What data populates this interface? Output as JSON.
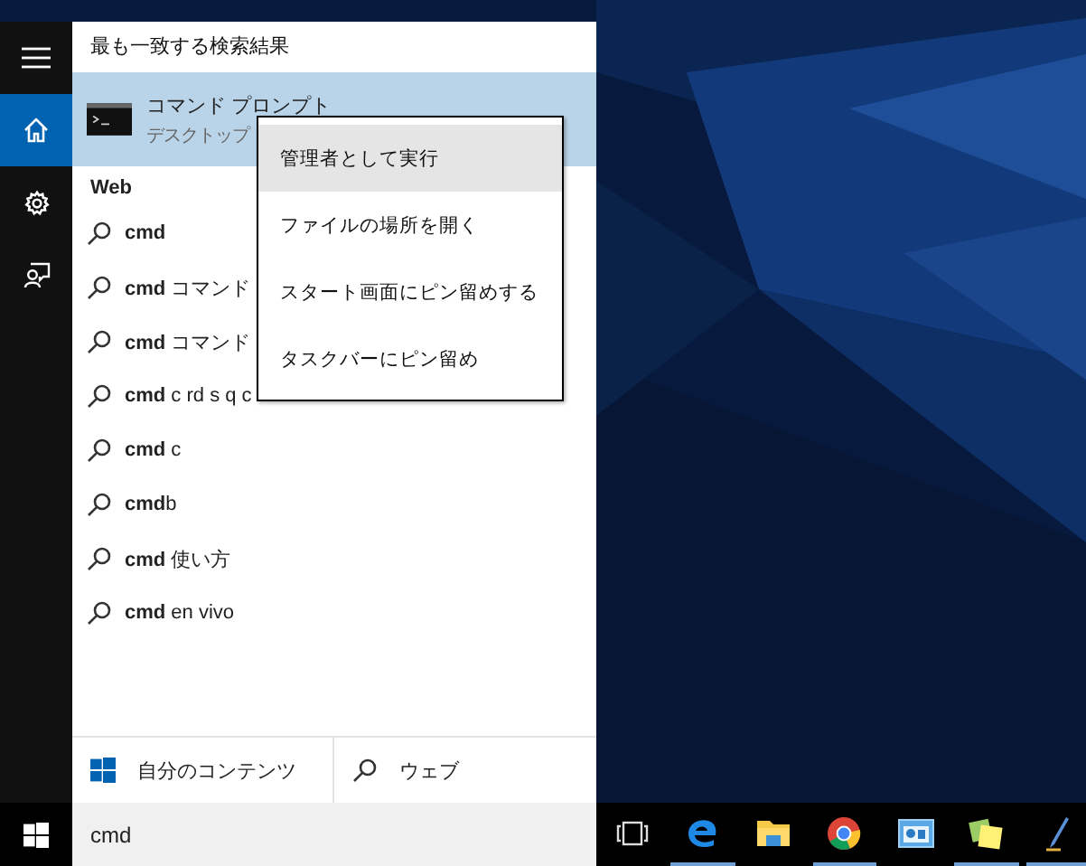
{
  "sidebar": {
    "items": [
      {
        "kind": "menu",
        "selected": false
      },
      {
        "kind": "home",
        "selected": true
      },
      {
        "kind": "settings",
        "selected": false
      },
      {
        "kind": "feedback",
        "selected": false
      }
    ]
  },
  "best_match": {
    "heading": "最も一致する検索結果",
    "title": "コマンド プロンプト",
    "subtitle": "デスクトップ",
    "selected": true
  },
  "web": {
    "heading": "Web",
    "suggestions": [
      {
        "query": "**cmd**"
      },
      {
        "query": "**cmd** コマンド"
      },
      {
        "query": "**cmd** コマンド"
      },
      {
        "query": "**cmd** c rd s q c"
      },
      {
        "query": "**cmd** c"
      },
      {
        "query": "**cmd**b"
      },
      {
        "query": "**cmd** 使い方"
      },
      {
        "query": "**cmd** en vivo"
      }
    ]
  },
  "context_menu": {
    "items": [
      {
        "label": "管理者として実行",
        "selected": true
      },
      {
        "label": "ファイルの場所を開く",
        "selected": false
      },
      {
        "label": "スタート画面にピン留めする",
        "selected": false
      },
      {
        "label": "タスクバーにピン留め",
        "selected": false
      }
    ]
  },
  "scope_tabs": [
    {
      "kind": "windows",
      "label": "自分のコンテンツ"
    },
    {
      "kind": "search",
      "label": "ウェブ"
    }
  ],
  "search_box": {
    "value": "cmd"
  },
  "taskbar": {
    "items": [
      {
        "kind": "task-view",
        "running": false
      },
      {
        "kind": "browser-e",
        "running": true
      },
      {
        "kind": "folder",
        "running": false
      },
      {
        "kind": "globe",
        "running": true
      },
      {
        "kind": "blue-app",
        "running": false
      },
      {
        "kind": "notes",
        "running": true
      },
      {
        "kind": "pen",
        "running": true
      }
    ]
  }
}
